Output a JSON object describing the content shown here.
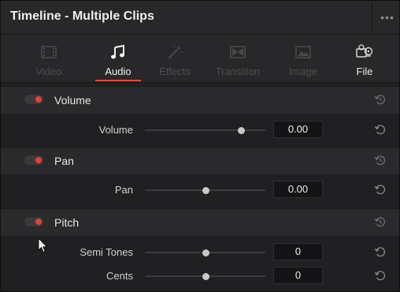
{
  "window": {
    "title": "Timeline - Multiple Clips",
    "more_icon": "ellipsis-icon"
  },
  "tabs": [
    {
      "label": "Video",
      "icon": "video-clip-icon",
      "state": "disabled"
    },
    {
      "label": "Audio",
      "icon": "music-note-icon",
      "state": "active"
    },
    {
      "label": "Effects",
      "icon": "magic-wand-icon",
      "state": "disabled"
    },
    {
      "label": "Transition",
      "icon": "transition-icon",
      "state": "disabled"
    },
    {
      "label": "Image",
      "icon": "image-icon",
      "state": "disabled"
    },
    {
      "label": "File",
      "icon": "file-reel-icon",
      "state": "enabled"
    }
  ],
  "sections": [
    {
      "title": "Volume",
      "enabled": true,
      "rows": [
        {
          "label": "Volume",
          "value": "0.00",
          "slider_position": 0.8
        }
      ]
    },
    {
      "title": "Pan",
      "enabled": true,
      "rows": [
        {
          "label": "Pan",
          "value": "0.00",
          "slider_position": 0.5
        }
      ]
    },
    {
      "title": "Pitch",
      "enabled": true,
      "rows": [
        {
          "label": "Semi Tones",
          "value": "0",
          "slider_position": 0.5
        },
        {
          "label": "Cents",
          "value": "0",
          "slider_position": 0.5
        }
      ]
    }
  ],
  "colors": {
    "accent": "#e64b3b",
    "toggle_on": "#e8412f",
    "panel_bg": "#222224",
    "header_bg": "#2a2a2c"
  }
}
